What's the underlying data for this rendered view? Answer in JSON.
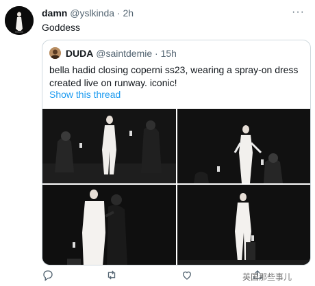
{
  "tweet": {
    "author_name": "damn",
    "author_handle": "@yslkinda",
    "separator": "·",
    "time": "2h",
    "text": "Goddess",
    "more_label": "···"
  },
  "quote": {
    "author_name": "DUDA",
    "author_handle": "@saintdemie",
    "separator": "·",
    "time": "15h",
    "text": "bella hadid closing coperni ss23, wearing a spray-on dress created live on runway. iconic!",
    "link": "Show this thread"
  },
  "media": {
    "images": [
      "runway-photo-1",
      "runway-photo-2",
      "runway-photo-3",
      "runway-photo-4"
    ]
  },
  "actions": {
    "icons": [
      "reply-icon",
      "retweet-icon",
      "like-icon",
      "share-icon"
    ]
  },
  "watermark": "英国那些事儿",
  "colors": {
    "link": "#1d9bf0",
    "muted": "#536471",
    "border": "#cfd9de"
  }
}
